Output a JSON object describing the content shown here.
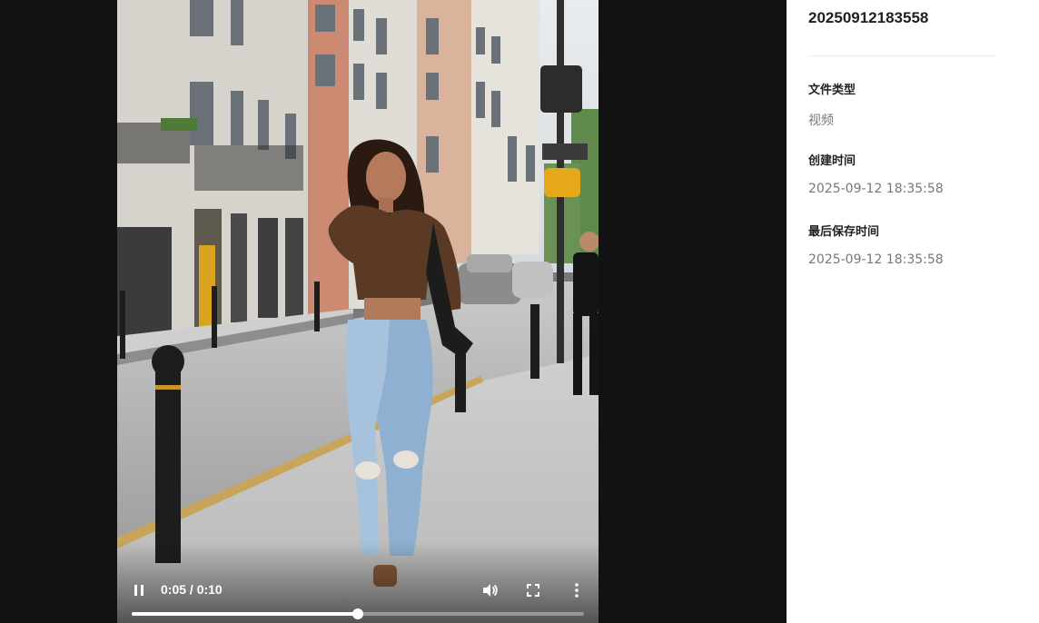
{
  "player": {
    "time_label": "0:05 / 0:10",
    "progress": 0.5,
    "play_state_icon": "pause-icon",
    "volume_icon": "volume-icon",
    "fullscreen_icon": "fullscreen-icon",
    "more_icon": "more-vertical-icon"
  },
  "details": {
    "file_name": "20250912183558",
    "type_label": "文件类型",
    "type_value": "视频",
    "created_label": "创建时间",
    "created_value": "2025-09-12 18:35:58",
    "saved_label": "最后保存时间",
    "saved_value": "2025-09-12 18:35:58"
  }
}
